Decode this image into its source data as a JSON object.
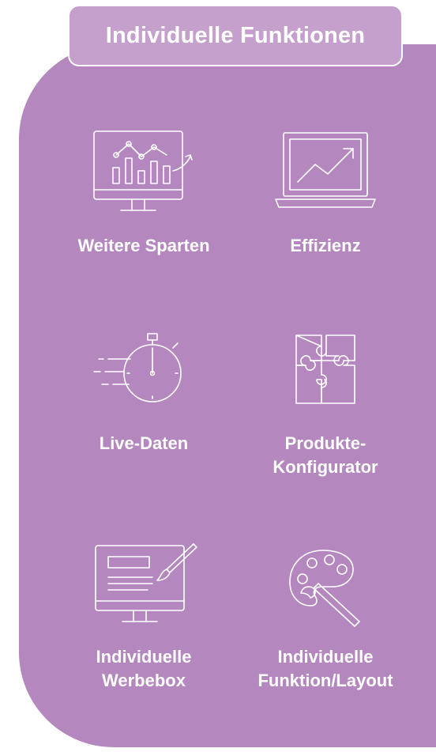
{
  "header": {
    "title": "Individuelle Funktionen"
  },
  "features": [
    {
      "label": "Weitere Sparten",
      "icon": "monitor-chart-icon"
    },
    {
      "label": "Effizienz",
      "icon": "laptop-growth-icon"
    },
    {
      "label": "Live-Daten",
      "icon": "stopwatch-icon"
    },
    {
      "label_lines": [
        "Produkte-",
        "Konfigurator"
      ],
      "icon": "puzzle-icon"
    },
    {
      "label_lines": [
        "Individuelle",
        "Werbebox"
      ],
      "icon": "monitor-edit-icon"
    },
    {
      "label_lines": [
        "Individuelle",
        "Funktion/Layout"
      ],
      "icon": "palette-icon"
    }
  ],
  "colors": {
    "panel": "#b488be",
    "header": "#c5a0cc",
    "text": "#ffffff"
  }
}
